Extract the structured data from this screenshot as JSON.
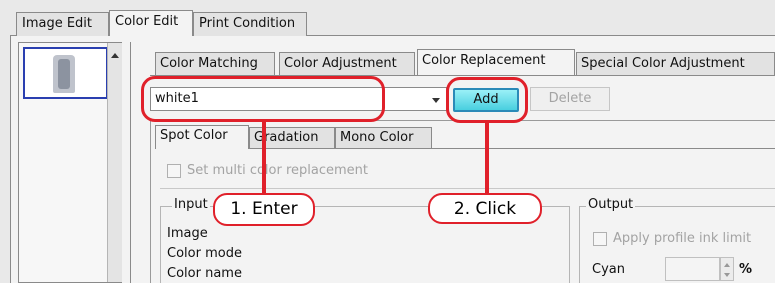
{
  "top_tabs": [
    {
      "label": "Image Edit",
      "active": false
    },
    {
      "label": "Color Edit",
      "active": true
    },
    {
      "label": "Print Condition",
      "active": false
    }
  ],
  "sub_tabs": [
    {
      "label": "Color Matching",
      "active": false
    },
    {
      "label": "Color Adjustment",
      "active": false
    },
    {
      "label": "Color Replacement",
      "active": true
    },
    {
      "label": "Special Color Adjustment",
      "active": false
    }
  ],
  "toolbar": {
    "name_value": "white1",
    "add_label": "Add",
    "delete_label": "Delete"
  },
  "inner_tabs": [
    {
      "label": "Spot Color",
      "active": true
    },
    {
      "label": "Gradation",
      "active": false
    },
    {
      "label": "Mono Color",
      "active": false
    }
  ],
  "multi_color": {
    "label": "Set multi color replacement",
    "checked": false,
    "enabled": false
  },
  "input": {
    "title": "Input",
    "rows": [
      "Image",
      "Color mode",
      "Color name"
    ]
  },
  "output": {
    "title": "Output",
    "apply_profile_label": "Apply profile ink limit",
    "cyan_label": "Cyan",
    "cyan_value": "",
    "cyan_unit": "%"
  },
  "annotations": {
    "step1": "1. Enter",
    "step2": "2. Click",
    "accent_color": "#e0202a"
  }
}
